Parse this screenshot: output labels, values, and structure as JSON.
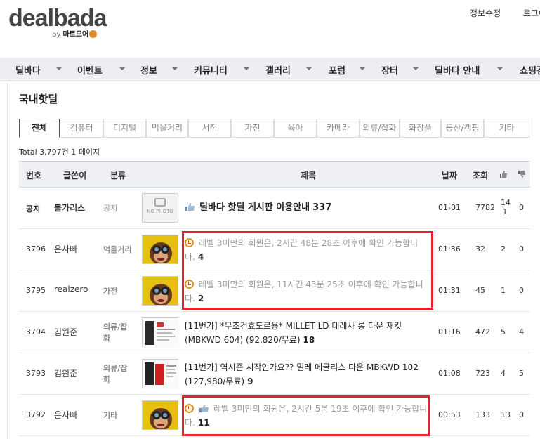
{
  "logo": {
    "main": "dealbada",
    "by": "by",
    "sub": "마트모어"
  },
  "top_links": [
    "정보수정",
    "로그아"
  ],
  "nav": [
    "딜바다",
    "이벤트",
    "정보",
    "커뮤니티",
    "갤러리",
    "포럼",
    "장터",
    "딜바다 안내",
    "쇼핑검"
  ],
  "board_title": "국내핫딜",
  "tabs": [
    "전체",
    "컴퓨터",
    "디지털",
    "먹을거리",
    "서적",
    "가전",
    "육아",
    "카메라",
    "의류/잡화",
    "화장품",
    "등산/캠핑",
    "기타"
  ],
  "active_tab": "전체",
  "total": "Total 3,797건 1 페이지",
  "columns": {
    "num": "번호",
    "writer": "글쓴이",
    "category": "분류",
    "title": "제목",
    "date": "날짜",
    "views": "조회"
  },
  "rows": [
    {
      "num": "공지",
      "writer": "불가리스",
      "category": "공지",
      "thumb": "NO PHOTO",
      "title": "딜바다 핫딜 게시판 이용안내",
      "comments": "337",
      "date": "01-01",
      "views": "7782",
      "like": "14 1",
      "dislike": "0",
      "notice": true
    },
    {
      "num": "3796",
      "writer": "은사빠",
      "category": "먹을거리",
      "title": "레벨 3미만의 회원은, 2시간 48분 28초 이후에 확인 가능합니다.",
      "comments": "4",
      "date": "01:36",
      "views": "32",
      "like": "2",
      "dislike": "0",
      "locked": true
    },
    {
      "num": "3795",
      "writer": "realzero",
      "category": "가전",
      "title": "레벨 3미만의 회원은, 11시간 43분 25초 이후에 확인 가능합니다.",
      "comments": "2",
      "date": "01:31",
      "views": "45",
      "like": "1",
      "dislike": "0",
      "locked": true
    },
    {
      "num": "3794",
      "writer": "김원준",
      "category": "의류/잡화",
      "title": "[11번가] *무조건효도르용* MILLET LD 테레사 롱 다운 재킷 (MBKWD 604) (92,820/무료)",
      "comments": "18",
      "date": "01:16",
      "views": "472",
      "like": "5",
      "dislike": "4"
    },
    {
      "num": "3793",
      "writer": "김원준",
      "category": "의류/잡화",
      "title": "[11번가] 역시즌 시작인가요?? 밀레 에글리스 다운 MBKWD 102 (127,980/무료)",
      "comments": "9",
      "date": "01:08",
      "views": "723",
      "like": "4",
      "dislike": "5"
    },
    {
      "num": "3792",
      "writer": "은사빠",
      "category": "기타",
      "title": "레벨 3미만의 회원은, 2시간 5분 19초 이후에 확인 가능합니다.",
      "comments": "11",
      "date": "00:53",
      "views": "133",
      "like": "13",
      "dislike": "0",
      "locked": true
    }
  ],
  "colors": {
    "highlight": "#e3222c",
    "nav_bg": "#eceef2",
    "header_bg": "#eef0f4"
  }
}
